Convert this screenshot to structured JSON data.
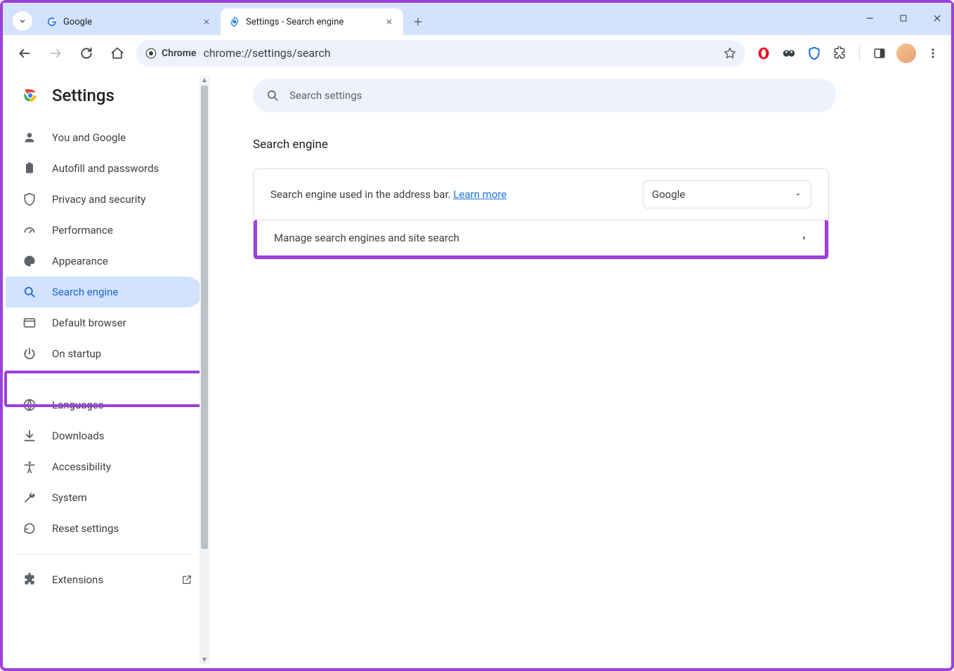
{
  "tabs": [
    {
      "title": "Google",
      "favicon": "google"
    },
    {
      "title": "Settings - Search engine",
      "favicon": "gear"
    }
  ],
  "omnibox": {
    "chip": "Chrome",
    "url": "chrome://settings/search"
  },
  "sidebar": {
    "title": "Settings",
    "items": [
      {
        "label": "You and Google"
      },
      {
        "label": "Autofill and passwords"
      },
      {
        "label": "Privacy and security"
      },
      {
        "label": "Performance"
      },
      {
        "label": "Appearance"
      },
      {
        "label": "Search engine"
      },
      {
        "label": "Default browser"
      },
      {
        "label": "On startup"
      }
    ],
    "items2": [
      {
        "label": "Languages"
      },
      {
        "label": "Downloads"
      },
      {
        "label": "Accessibility"
      },
      {
        "label": "System"
      },
      {
        "label": "Reset settings"
      }
    ],
    "items3": [
      {
        "label": "Extensions"
      }
    ]
  },
  "main": {
    "search_placeholder": "Search settings",
    "section_title": "Search engine",
    "row1_label": "Search engine used in the address bar. ",
    "row1_learn": "Learn more",
    "select_value": "Google",
    "row2_label": "Manage search engines and site search"
  }
}
